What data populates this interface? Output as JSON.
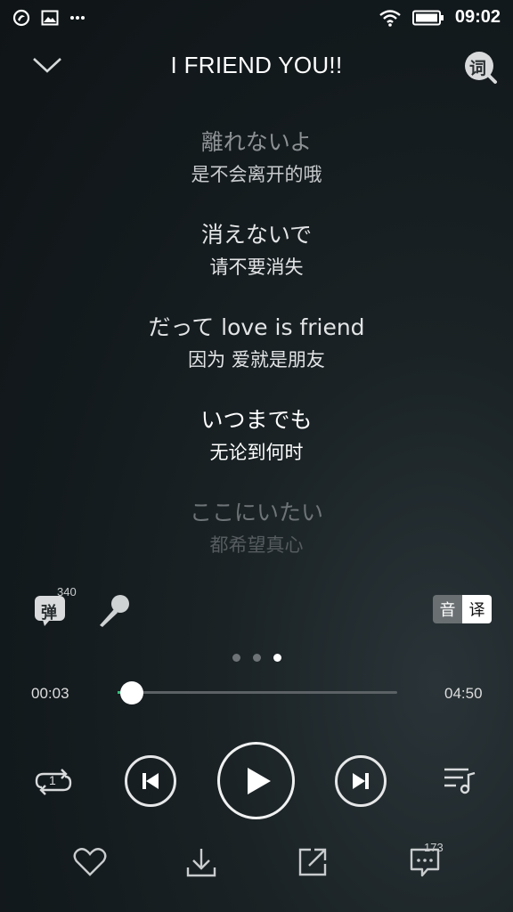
{
  "status": {
    "time": "09:02"
  },
  "header": {
    "title": "I FRIEND YOU!!",
    "lyric_button_label": "词"
  },
  "lyrics": [
    {
      "jp": "離れないよ",
      "cn": "是不会离开的哦",
      "jp_color": "#8c9194",
      "cn_color": "#c8cbcd"
    },
    {
      "jp": "消えないで",
      "cn": "请不要消失",
      "jp_color": "#e2e4e5",
      "cn_color": "#e2e4e5"
    },
    {
      "jp": "だって love is friend",
      "cn": "因为 爱就是朋友",
      "jp_color": "#e2e4e5",
      "cn_color": "#e2e4e5"
    },
    {
      "jp": "いつまでも",
      "cn": "无论到何时",
      "jp_color": "#ffffff",
      "cn_color": "#ffffff"
    },
    {
      "jp": "ここにいたい",
      "cn": "都希望真心",
      "jp_color": "#6e7477",
      "cn_color": "#565c5f"
    }
  ],
  "tools": {
    "danmu_label": "弹",
    "danmu_count": "340",
    "yin_label": "音",
    "yi_label": "译"
  },
  "pager": {
    "count": 3,
    "active": 2
  },
  "progress": {
    "current": "00:03",
    "total": "04:50",
    "fraction": 0.01,
    "accent": "#31c27c"
  },
  "controls": {
    "repeat_label": "1"
  },
  "actions": {
    "comment_count": "173"
  }
}
